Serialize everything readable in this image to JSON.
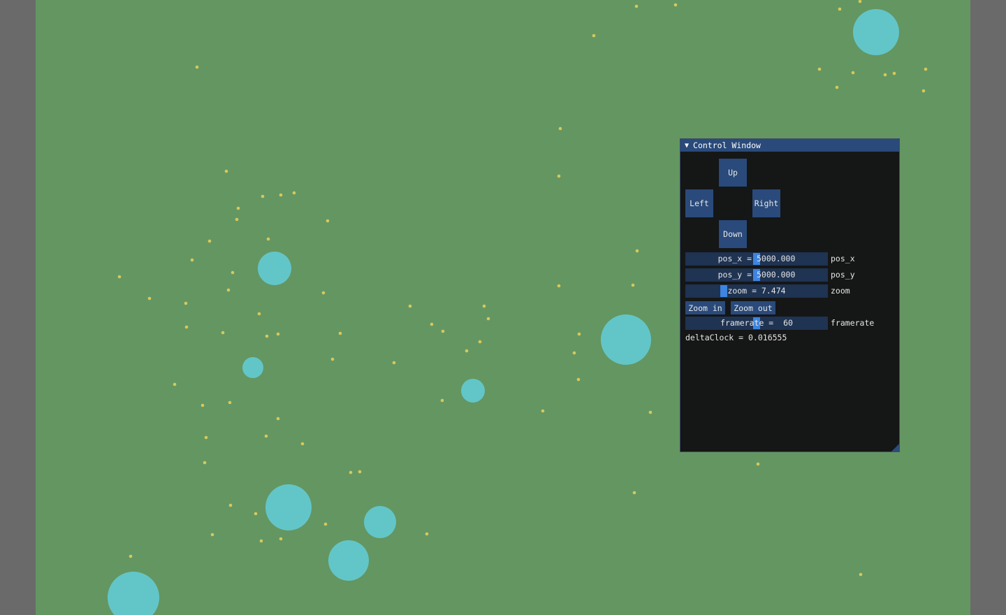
{
  "window": {
    "title": "Control Window",
    "collapse_arrow": "▼"
  },
  "buttons": {
    "up": "Up",
    "left": "Left",
    "right": "Right",
    "down": "Down",
    "zoom_in": "Zoom in",
    "zoom_out": "Zoom out"
  },
  "sliders": {
    "pos_x": {
      "display": "pos_x = 5000.000",
      "label": "pos_x",
      "value": 5000.0
    },
    "pos_y": {
      "display": "pos_y = 5000.000",
      "label": "pos_y",
      "value": 5000.0
    },
    "zoom": {
      "display": "zoom = 7.474",
      "label": "zoom",
      "value": 7.474
    },
    "framerate": {
      "display": "framerate =  60",
      "label": "framerate",
      "value": 60
    }
  },
  "delta_clock": "deltaClock = 0.016555",
  "colors": {
    "background": "#649662",
    "border_sides": "#6a6a6a",
    "blob": "#62c6c8",
    "food": "#d6c95a",
    "window_bg": "#151616",
    "title_bar": "#294a7a",
    "button": "#294a7a",
    "slider_bg": "#1f3352",
    "slider_grab": "#3d85e0"
  }
}
